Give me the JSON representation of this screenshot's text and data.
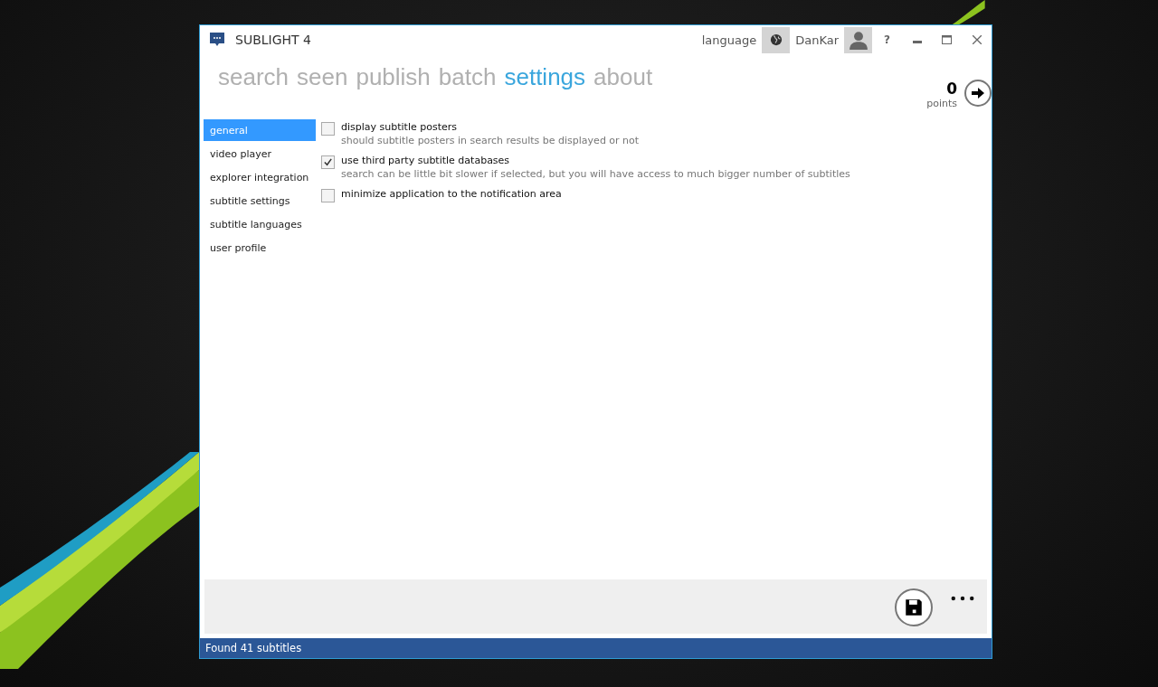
{
  "window": {
    "title": "SUBLIGHT 4"
  },
  "header": {
    "language": "language",
    "user": "DanKar",
    "help": "?"
  },
  "tabs": [
    {
      "label": "search",
      "selected": false
    },
    {
      "label": "seen",
      "selected": false
    },
    {
      "label": "publish",
      "selected": false
    },
    {
      "label": "batch",
      "selected": false
    },
    {
      "label": "settings",
      "selected": true
    },
    {
      "label": "about",
      "selected": false
    }
  ],
  "points": {
    "value": "0",
    "label": "points"
  },
  "sidebar": {
    "items": [
      {
        "label": "general",
        "selected": true
      },
      {
        "label": "video player",
        "selected": false
      },
      {
        "label": "explorer integration",
        "selected": false
      },
      {
        "label": "subtitle settings",
        "selected": false
      },
      {
        "label": "subtitle languages",
        "selected": false
      },
      {
        "label": "user profile",
        "selected": false
      }
    ]
  },
  "options": [
    {
      "label": "display subtitle posters",
      "description": "should subtitle posters in search results be displayed or not",
      "checked": false
    },
    {
      "label": "use third party subtitle databases",
      "description": "search can be little bit slower if selected, but you will have access to much bigger number of subtitles",
      "checked": true
    },
    {
      "label": "minimize application to the notification area",
      "checked": false
    }
  ],
  "status_bar": "Found 41 subtitles"
}
